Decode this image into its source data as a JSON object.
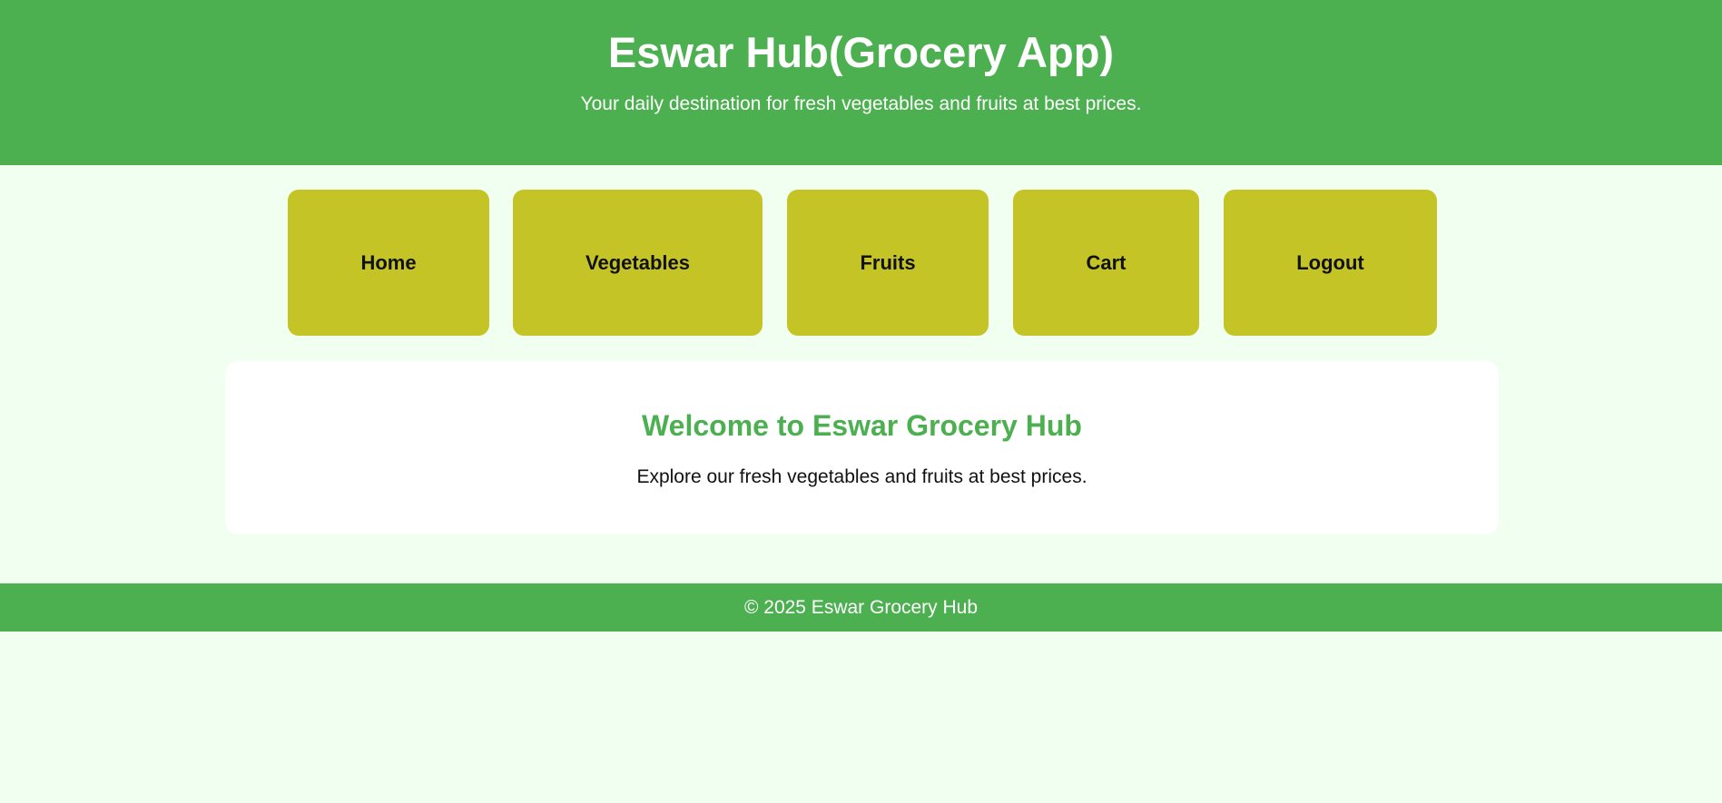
{
  "header": {
    "title": "Eswar Hub(Grocery App)",
    "tagline": "Your daily destination for fresh vegetables and fruits at best prices."
  },
  "nav": {
    "items": [
      {
        "label": "Home"
      },
      {
        "label": "Vegetables"
      },
      {
        "label": "Fruits"
      },
      {
        "label": "Cart"
      },
      {
        "label": "Logout"
      }
    ]
  },
  "welcome": {
    "heading": "Welcome to Eswar Grocery Hub",
    "text": "Explore our fresh vegetables and fruits at best prices."
  },
  "footer": {
    "text": "© 2025 Eswar Grocery Hub"
  },
  "colors": {
    "primary_green": "#4caf50",
    "nav_button": "#c5c427",
    "page_background": "#f0fff0",
    "card_background": "#ffffff"
  }
}
